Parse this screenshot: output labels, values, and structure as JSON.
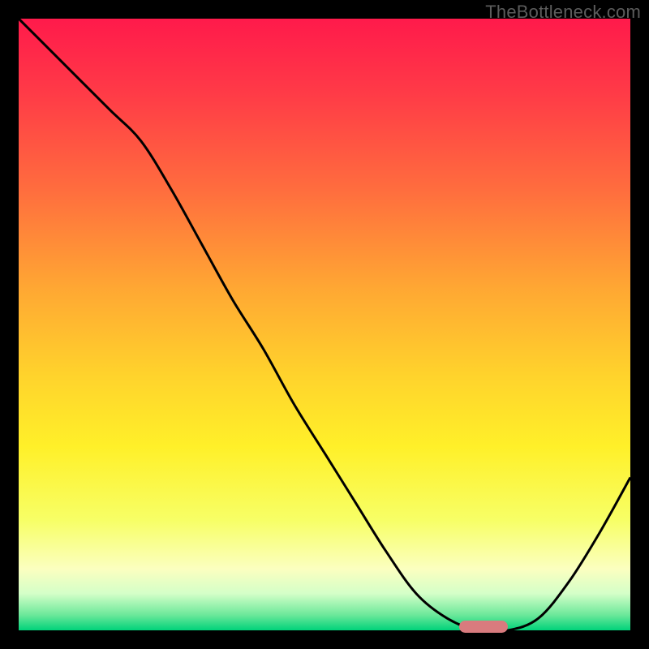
{
  "watermark": "TheBottleneck.com",
  "plot": {
    "inner_x": 23,
    "inner_y": 23,
    "inner_w": 754,
    "inner_h": 754
  },
  "chart_data": {
    "type": "line",
    "title": "",
    "xlabel": "",
    "ylabel": "",
    "xlim": [
      0,
      100
    ],
    "ylim": [
      0,
      100
    ],
    "grid": false,
    "legend": false,
    "x": [
      0,
      5,
      10,
      15,
      20,
      25,
      30,
      35,
      40,
      45,
      50,
      55,
      60,
      65,
      70,
      75,
      80,
      85,
      90,
      95,
      100
    ],
    "values": [
      100,
      95,
      90,
      85,
      80,
      72,
      63,
      54,
      46,
      37,
      29,
      21,
      13,
      6,
      2,
      0,
      0,
      2,
      8,
      16,
      25
    ],
    "marker": {
      "x_start": 72,
      "x_end": 80,
      "y": 0.5
    }
  },
  "gradient_stops": [
    {
      "offset": 0.0,
      "color": "#ff1a4b"
    },
    {
      "offset": 0.12,
      "color": "#ff3a47"
    },
    {
      "offset": 0.28,
      "color": "#ff6d3e"
    },
    {
      "offset": 0.44,
      "color": "#ffa733"
    },
    {
      "offset": 0.58,
      "color": "#ffd22c"
    },
    {
      "offset": 0.7,
      "color": "#fff029"
    },
    {
      "offset": 0.82,
      "color": "#f7ff66"
    },
    {
      "offset": 0.9,
      "color": "#fbffc0"
    },
    {
      "offset": 0.94,
      "color": "#d4ffc8"
    },
    {
      "offset": 0.975,
      "color": "#6be89a"
    },
    {
      "offset": 1.0,
      "color": "#00d27a"
    }
  ],
  "curve_color": "#000000",
  "curve_width": 3
}
